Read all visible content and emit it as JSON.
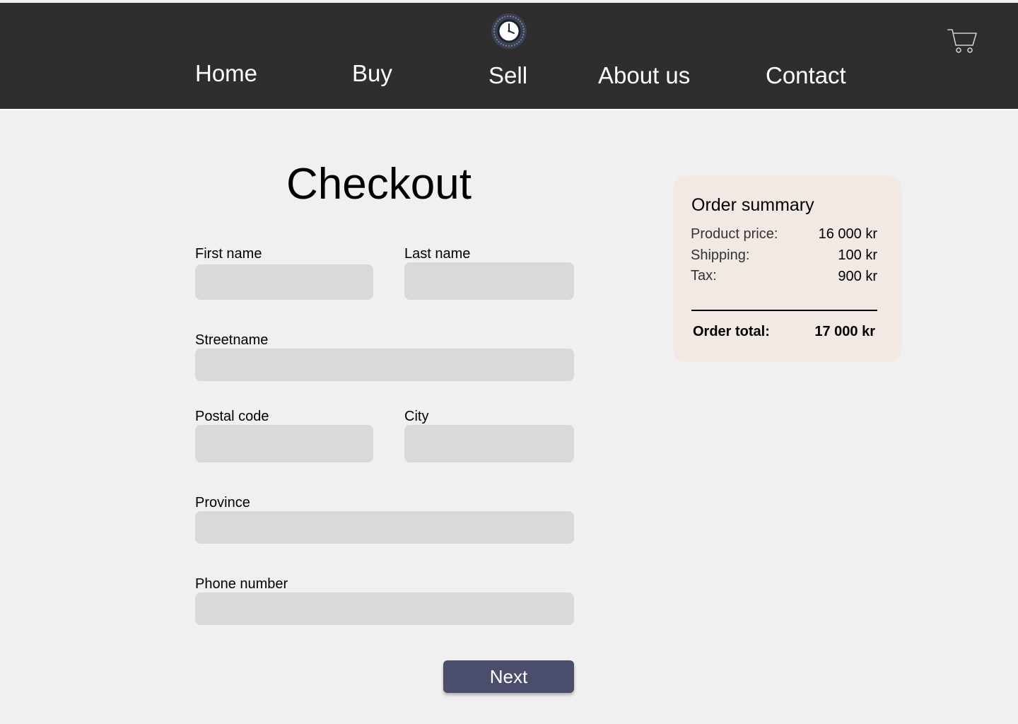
{
  "header": {
    "logo_icon": "clock-icon",
    "nav": {
      "home": "Home",
      "buy": "Buy",
      "sell": "Sell",
      "about": "About us",
      "contact": "Contact"
    },
    "cart_icon": "cart-icon"
  },
  "checkout": {
    "title": "Checkout",
    "fields": {
      "first_name": {
        "label": "First name",
        "value": ""
      },
      "last_name": {
        "label": "Last name",
        "value": ""
      },
      "street": {
        "label": "Streetname",
        "value": ""
      },
      "postal_code": {
        "label": "Postal code",
        "value": ""
      },
      "city": {
        "label": "City",
        "value": ""
      },
      "province": {
        "label": "Province",
        "value": ""
      },
      "phone": {
        "label": "Phone number",
        "value": ""
      }
    },
    "next_label": "Next"
  },
  "summary": {
    "title": "Order summary",
    "product_price_label": "Product price:",
    "product_price_value": "16 000 kr",
    "shipping_label": "Shipping:",
    "shipping_value": "100 kr",
    "tax_label": "Tax:",
    "tax_value": "900 kr",
    "total_label": "Order total:",
    "total_value": "17 000 kr"
  },
  "colors": {
    "header_bg": "#2e2e2e",
    "page_bg": "#f0f0f0",
    "input_bg": "#d9d9d9",
    "button_bg": "#4a4d6b",
    "summary_bg": "#f2e9e4"
  }
}
